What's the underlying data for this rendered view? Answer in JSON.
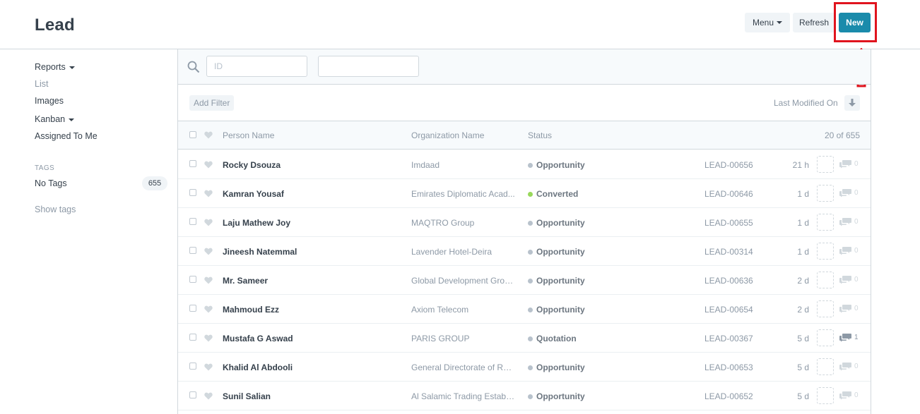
{
  "page": {
    "title": "Lead"
  },
  "toolbar": {
    "menu_label": "Menu",
    "refresh_label": "Refresh",
    "new_label": "New"
  },
  "sidebar": {
    "items": [
      {
        "label": "Reports",
        "dropdown": true
      },
      {
        "label": "List",
        "dropdown": false
      },
      {
        "label": "Images",
        "dropdown": false
      },
      {
        "label": "Kanban",
        "dropdown": true
      },
      {
        "label": "Assigned To Me",
        "dropdown": false
      }
    ],
    "tags_header": "TAGS",
    "no_tags_label": "No Tags",
    "no_tags_count": "655",
    "show_tags_label": "Show tags"
  },
  "filters": {
    "id_placeholder": "ID",
    "second_placeholder": ""
  },
  "sort": {
    "add_filter_label": "Add Filter",
    "sort_label": "Last Modified On"
  },
  "columns": {
    "person": "Person Name",
    "org": "Organization Name",
    "status": "Status",
    "count": "20 of 655"
  },
  "colors": {
    "primary": "#1a8bab",
    "highlight": "#e0141e",
    "converted": "#98d85b",
    "neutral_dot": "#b8c2cc"
  },
  "rows": [
    {
      "name": "Rocky Dsouza",
      "org": "Imdaad",
      "status": "Opportunity",
      "status_color": "#b8c2cc",
      "id": "LEAD-00656",
      "ago": "21 h",
      "comments": "0"
    },
    {
      "name": "Kamran Yousaf",
      "org": "Emirates Diplomatic Acad...",
      "status": "Converted",
      "status_color": "#98d85b",
      "id": "LEAD-00646",
      "ago": "1 d",
      "comments": "0"
    },
    {
      "name": "Laju Mathew Joy",
      "org": "MAQTRO Group",
      "status": "Opportunity",
      "status_color": "#b8c2cc",
      "id": "LEAD-00655",
      "ago": "1 d",
      "comments": "0"
    },
    {
      "name": "Jineesh Natemmal",
      "org": "Lavender Hotel-Deira",
      "status": "Opportunity",
      "status_color": "#b8c2cc",
      "id": "LEAD-00314",
      "ago": "1 d",
      "comments": "0"
    },
    {
      "name": "Mr. Sameer",
      "org": "Global Development Grou...",
      "status": "Opportunity",
      "status_color": "#b8c2cc",
      "id": "LEAD-00636",
      "ago": "2 d",
      "comments": "0"
    },
    {
      "name": "Mahmoud Ezz",
      "org": "Axiom Telecom",
      "status": "Opportunity",
      "status_color": "#b8c2cc",
      "id": "LEAD-00654",
      "ago": "2 d",
      "comments": "0"
    },
    {
      "name": "Mustafa G Aswad",
      "org": "PARIS GROUP",
      "status": "Quotation",
      "status_color": "#b8c2cc",
      "id": "LEAD-00367",
      "ago": "5 d",
      "comments": "1"
    },
    {
      "name": "Khalid Al Abdooli",
      "org": "General Directorate of Res...",
      "status": "Opportunity",
      "status_color": "#b8c2cc",
      "id": "LEAD-00653",
      "ago": "5 d",
      "comments": "0"
    },
    {
      "name": "Sunil Salian",
      "org": "Al Salamic Trading Establis...",
      "status": "Opportunity",
      "status_color": "#b8c2cc",
      "id": "LEAD-00652",
      "ago": "5 d",
      "comments": "0"
    }
  ]
}
